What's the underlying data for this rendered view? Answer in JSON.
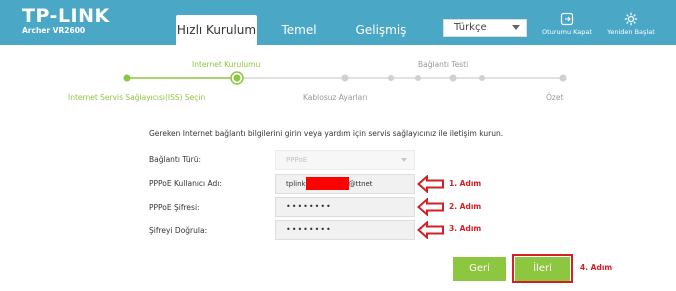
{
  "header": {
    "logo": "TP-LINK",
    "model": "Archer VR2600",
    "tabs": [
      {
        "label": "Hızlı Kurulum",
        "active": true
      },
      {
        "label": "Temel",
        "active": false
      },
      {
        "label": "Gelişmiş",
        "active": false
      }
    ],
    "language": "Türkçe",
    "logout_label": "Oturumu Kapat",
    "reboot_label": "Yeniden Başlat"
  },
  "progress": {
    "top_labels": [
      "Internet Kurulumu",
      "Bağlantı Testi"
    ],
    "bottom_labels": [
      "Internet Servis Sağlayıcısı(ISS) Seçin",
      "Kablosuz Ayarları",
      "Özet"
    ],
    "current_step": 2,
    "total_steps": 8
  },
  "form": {
    "intro": "Gereken Internet bağlantı bilgilerini girin veya yardım için servis sağlayıcınız ile iletişim kurun.",
    "connection_type_label": "Bağlantı Türü:",
    "connection_type_value": "PPPoE",
    "username_label": "PPPoE Kullanıcı Adı:",
    "username_prefix": "tplink",
    "username_suffix": "@ttnet",
    "password_label": "PPPoE Şifresi:",
    "password_value": "••••••••",
    "confirm_label": "Şifreyi Doğrula:",
    "confirm_value": "••••••••"
  },
  "annotations": {
    "step1": "1. Adım",
    "step2": "2. Adım",
    "step3": "3. Adım",
    "step4": "4. Adım",
    "color": "#d31f25"
  },
  "buttons": {
    "back": "Geri",
    "next": "İleri"
  },
  "colors": {
    "header": "#4aa8c6",
    "accent_green": "#8dc63f",
    "annotation_red": "#d31f25"
  }
}
